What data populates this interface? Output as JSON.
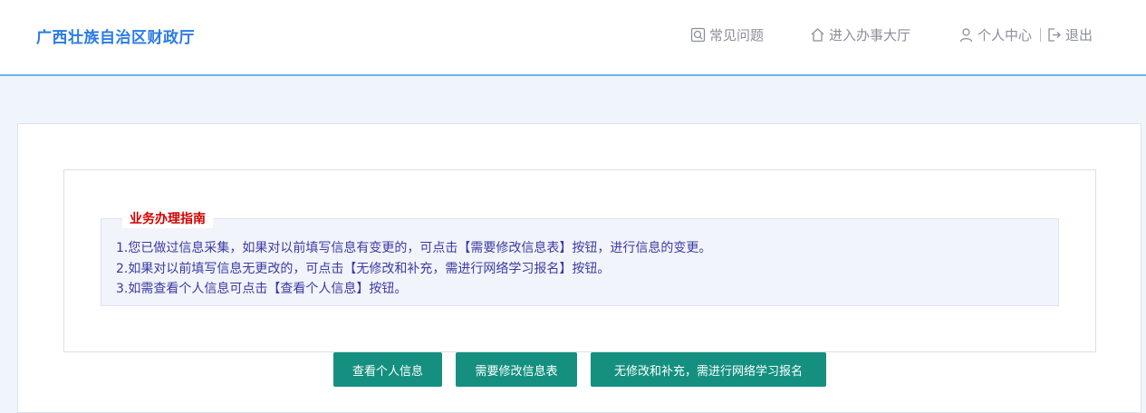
{
  "header": {
    "brand": "广西壮族自治区财政厅",
    "nav": {
      "faq": "常见问题",
      "hall": "进入办事大厅",
      "personal_center": "个人中心",
      "logout": "退出"
    }
  },
  "guide": {
    "title": "业务办理指南",
    "lines": [
      "1.您已做过信息采集，如果对以前填写信息有变更的，可点击【需要修改信息表】按钮，进行信息的变更。",
      "2.如果对以前填写信息无更改的，可点击【无修改和补充，需进行网络学习报名】按钮。",
      "3.如需查看个人信息可点击【查看个人信息】按钮。"
    ]
  },
  "buttons": {
    "view_info": "查看个人信息",
    "modify_info": "需要修改信息表",
    "no_change_register": "无修改和补充，需进行网络学习报名"
  },
  "colors": {
    "brand": "#2a7be4",
    "guide_title": "#d40000",
    "guide_text": "#3b3aa5",
    "button_bg": "#159080",
    "header_border": "#6fb1ec"
  },
  "icons": {
    "faq": "search-doc-icon",
    "hall": "home-icon",
    "personal_center": "user-icon",
    "logout": "logout-icon"
  }
}
